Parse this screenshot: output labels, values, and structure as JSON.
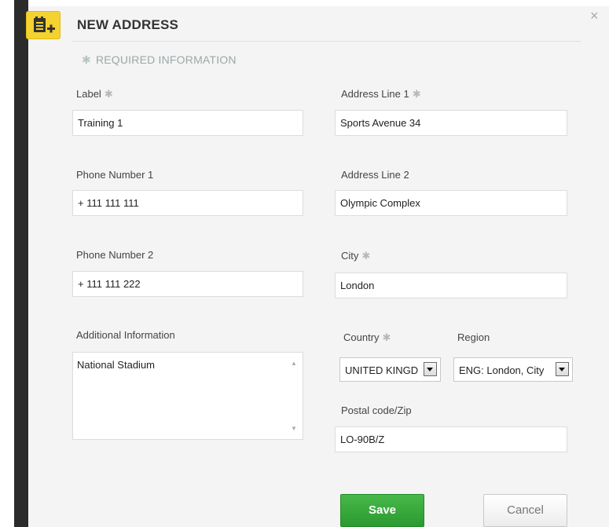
{
  "dialog": {
    "title": "NEW ADDRESS",
    "close_glyph": "×",
    "required_note": "REQUIRED INFORMATION",
    "required_star": "✱"
  },
  "fields": {
    "label": {
      "label": "Label",
      "value": "Training 1",
      "required": true
    },
    "phone1": {
      "label": "Phone Number 1",
      "value": "+ 111 111 111"
    },
    "phone2": {
      "label": "Phone Number 2",
      "value": "+ 111 111 222"
    },
    "additional": {
      "label": "Additional Information",
      "value": "National Stadium"
    },
    "address1": {
      "label": "Address Line 1",
      "value": "Sports Avenue 34",
      "required": true
    },
    "address2": {
      "label": "Address Line 2",
      "value": "Olympic Complex"
    },
    "city": {
      "label": "City",
      "value": "London",
      "required": true
    },
    "country": {
      "label": "Country",
      "selected": "UNITED KINGD",
      "required": true
    },
    "region": {
      "label": "Region",
      "selected": "ENG: London, City"
    },
    "postal": {
      "label": "Postal code/Zip",
      "value": "LO-90B/Z"
    }
  },
  "buttons": {
    "save": "Save",
    "cancel": "Cancel"
  },
  "icons": {
    "header": "address-book-add-icon",
    "close": "close-icon",
    "scroll_up": "scroll-up-arrow-icon",
    "scroll_down": "scroll-down-arrow-icon",
    "dropdown": "dropdown-arrow-icon"
  },
  "colors": {
    "save_green": "#2a9a30",
    "icon_yellow": "#f4d22f",
    "dialog_bg": "#f4f4f4"
  }
}
